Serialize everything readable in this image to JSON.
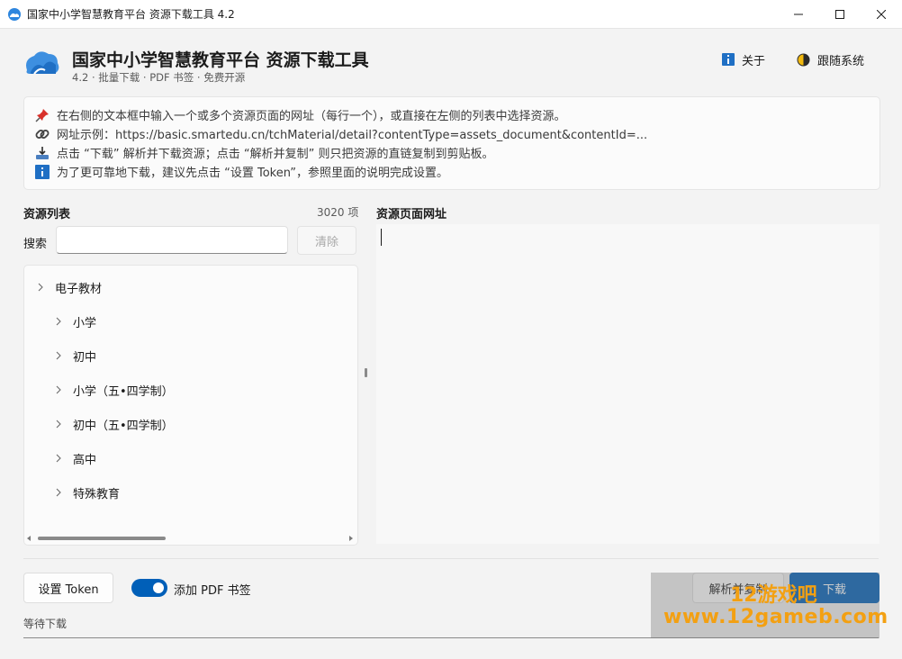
{
  "window": {
    "title": "国家中小学智慧教育平台 资源下载工具 4.2",
    "controls": [
      "minimize",
      "maximize",
      "close"
    ]
  },
  "header": {
    "title": "国家中小学智慧教育平台 资源下载工具",
    "subtitle": "4.2 · 批量下载 · PDF 书签 · 免费开源",
    "about_label": "关于",
    "theme_label": "跟随系统"
  },
  "info": {
    "line1": "在右侧的文本框中输入一个或多个资源页面的网址（每行一个），或直接在左侧的列表中选择资源。",
    "line2": "网址示例：https://basic.smartedu.cn/tchMaterial/detail?contentType=assets_document&contentId=...",
    "line3": "点击 “下载” 解析并下载资源；点击 “解析并复制” 则只把资源的直链复制到剪贴板。",
    "line4": "为了更可靠地下载，建议先点击 “设置 Token”，参照里面的说明完成设置。"
  },
  "resources": {
    "title": "资源列表",
    "count": "3020 项",
    "search_label": "搜索",
    "search_value": "",
    "clear_label": "清除",
    "tree": [
      {
        "label": "电子教材",
        "level": 0
      },
      {
        "label": "小学",
        "level": 1
      },
      {
        "label": "初中",
        "level": 1
      },
      {
        "label": "小学（五•四学制）",
        "level": 1
      },
      {
        "label": "初中（五•四学制）",
        "level": 1
      },
      {
        "label": "高中",
        "level": 1
      },
      {
        "label": "特殊教育",
        "level": 1
      }
    ]
  },
  "urls": {
    "title": "资源页面网址",
    "value": ""
  },
  "footer": {
    "token_label": "设置 Token",
    "pdf_bookmark_label": "添加 PDF 书签",
    "pdf_bookmark_on": true,
    "parse_copy_label": "解析并复制",
    "download_label": "下载",
    "status": "等待下载",
    "progress": 0
  },
  "watermark": {
    "line1": "12游戏吧",
    "line2": "www.12gameb.com"
  },
  "colors": {
    "accent": "#005fb8",
    "background": "#f3f3f3",
    "watermark": "#f3a012"
  }
}
